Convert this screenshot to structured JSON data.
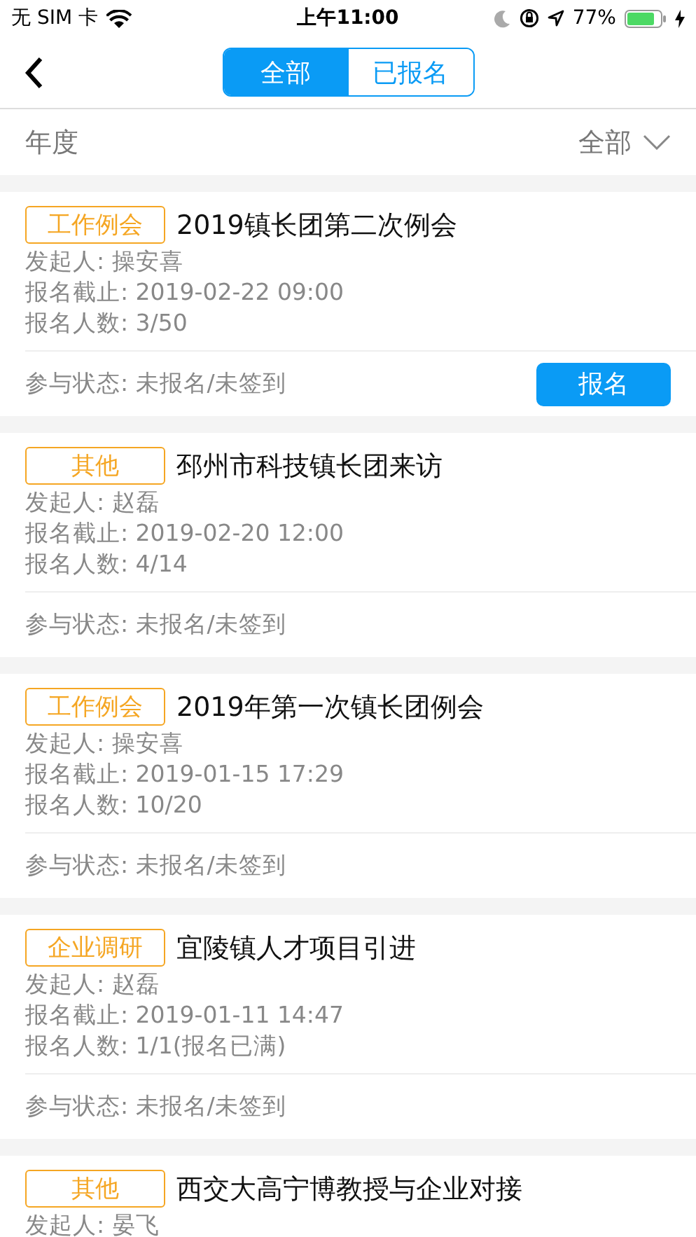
{
  "status_bar": {
    "carrier": "无 SIM 卡",
    "time": "上午11:00",
    "battery": "77%"
  },
  "segments": [
    {
      "label": "全部",
      "selected": true
    },
    {
      "label": "已报名",
      "selected": false
    }
  ],
  "filter": {
    "label": "年度",
    "value": "全部"
  },
  "events": [
    {
      "tag": "工作例会",
      "title": "2019镇长团第二次例会",
      "lines": [
        "发起人: 操安喜",
        "报名截止: 2019-02-22 09:00",
        "报名人数: 3/50"
      ],
      "status": "参与状态: 未报名/未签到",
      "action": "报名"
    },
    {
      "tag": "其他",
      "title": "邳州市科技镇长团来访",
      "lines": [
        "发起人: 赵磊",
        "报名截止: 2019-02-20 12:00",
        "报名人数: 4/14"
      ],
      "status": "参与状态: 未报名/未签到"
    },
    {
      "tag": "工作例会",
      "title": "2019年第一次镇长团例会",
      "lines": [
        "发起人: 操安喜",
        "报名截止: 2019-01-15 17:29",
        "报名人数: 10/20"
      ],
      "status": "参与状态: 未报名/未签到"
    },
    {
      "tag": "企业调研",
      "title": "宜陵镇人才项目引进",
      "lines": [
        "发起人: 赵磊",
        "报名截止: 2019-01-11 14:47",
        "报名人数: 1/1(报名已满)"
      ],
      "status": "参与状态: 未报名/未签到"
    },
    {
      "tag": "其他",
      "title": "西交大高宁博教授与企业对接",
      "lines": [
        "发起人: 晏飞"
      ]
    }
  ]
}
